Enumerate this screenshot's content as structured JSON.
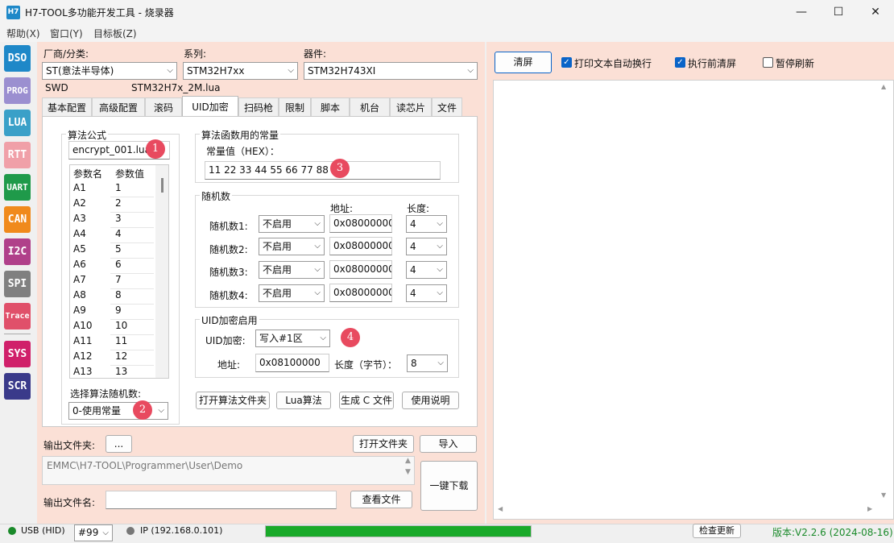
{
  "window": {
    "title": "H7-TOOL多功能开发工具 - 烧录器",
    "icon_text": "H7",
    "minimize": "—",
    "maximize": "☐",
    "close": "✕"
  },
  "menu": [
    "帮助(X)",
    "窗口(Y)",
    "目标板(Z)"
  ],
  "sidebar": [
    {
      "label": "DSO",
      "color": "#1e88c8"
    },
    {
      "label": "PROG",
      "color": "#9b8fd0"
    },
    {
      "label": "LUA",
      "color": "#3aa0c8"
    },
    {
      "label": "RTT",
      "color": "#f0a0a8"
    },
    {
      "label": "UART",
      "color": "#1f9a4a"
    },
    {
      "label": "CAN",
      "color": "#f08a1c"
    },
    {
      "label": "I2C",
      "color": "#b0408a"
    },
    {
      "label": "SPI",
      "color": "#808080"
    },
    {
      "label": "Trace",
      "color": "#e0506a"
    },
    {
      "label": "SYS",
      "color": "#d0206a"
    },
    {
      "label": "SCR",
      "color": "#3a3a8a"
    }
  ],
  "device": {
    "vendor_label": "厂商/分类:",
    "vendor_value": "ST(意法半导体)",
    "series_label": "系列:",
    "series_value": "STM32H7xx",
    "device_label": "器件:",
    "device_value": "STM32H743XI",
    "interface": "SWD",
    "lua_file": "STM32H7x_2M.lua"
  },
  "tabs": [
    "基本配置",
    "高级配置",
    "滚码",
    "UID加密",
    "扫码枪",
    "限制",
    "脚本",
    "机台",
    "读芯片",
    "文件"
  ],
  "active_tab": "UID加密",
  "algo": {
    "group_title": "算法公式",
    "file": "encrypt_001.lua",
    "col_name": "参数名",
    "col_value": "参数值",
    "params": [
      [
        "A1",
        "1"
      ],
      [
        "A2",
        "2"
      ],
      [
        "A3",
        "3"
      ],
      [
        "A4",
        "4"
      ],
      [
        "A5",
        "5"
      ],
      [
        "A6",
        "6"
      ],
      [
        "A7",
        "7"
      ],
      [
        "A8",
        "8"
      ],
      [
        "A9",
        "9"
      ],
      [
        "A10",
        "10"
      ],
      [
        "A11",
        "11"
      ],
      [
        "A12",
        "12"
      ],
      [
        "A13",
        "13"
      ]
    ],
    "random_select_label": "选择算法随机数:",
    "random_select_value": "0-使用常量"
  },
  "constant": {
    "group_title": "算法函数用的常量",
    "hex_label": "常量值（HEX）：",
    "hex_value": "11 22 33 44 55 66 77 88"
  },
  "random": {
    "group_title": "随机数",
    "addr_header": "地址:",
    "len_header": "长度:",
    "rows": [
      {
        "label": "随机数1:",
        "mode": "不启用",
        "addr": "0x08000000",
        "len": "4"
      },
      {
        "label": "随机数2:",
        "mode": "不启用",
        "addr": "0x08000000",
        "len": "4"
      },
      {
        "label": "随机数3:",
        "mode": "不启用",
        "addr": "0x08000000",
        "len": "4"
      },
      {
        "label": "随机数4:",
        "mode": "不启用",
        "addr": "0x08000000",
        "len": "4"
      }
    ]
  },
  "uid": {
    "group_title": "UID加密启用",
    "enc_label": "UID加密:",
    "enc_value": "写入#1区",
    "addr_label": "地址:",
    "addr_value": "0x08100000",
    "len_label": "长度（字节）：",
    "len_value": "8"
  },
  "actions": {
    "open_algo_folder": "打开算法文件夹",
    "lua_algo": "Lua算法",
    "gen_c": "生成 C 文件",
    "help": "使用说明"
  },
  "badges": [
    "1",
    "2",
    "3",
    "4"
  ],
  "output": {
    "folder_label": "输出文件夹:",
    "browse": "...",
    "open_folder": "打开文件夹",
    "import": "导入",
    "path": "EMMC\\H7-TOOL\\Programmer\\User\\Demo",
    "name_label": "输出文件名:",
    "name_value": "",
    "view_file": "查看文件",
    "one_click": "一键下载"
  },
  "right": {
    "clear": "清屏",
    "wrap_label": "打印文本自动换行",
    "wrap_checked": true,
    "clear_before_label": "执行前清屏",
    "clear_before_checked": true,
    "pause_label": "暂停刷新",
    "pause_checked": false
  },
  "status": {
    "usb": "USB (HID)",
    "usb_color": "#1a8a2a",
    "port": "#99",
    "ip": "IP (192.168.0.101)",
    "ip_color": "#777777",
    "progress": 1.0,
    "progress_color": "#1aaa2a",
    "check_update": "检查更新",
    "version": "版本:V2.2.6 (2024-08-16)",
    "version_color": "#1a8a2a"
  }
}
